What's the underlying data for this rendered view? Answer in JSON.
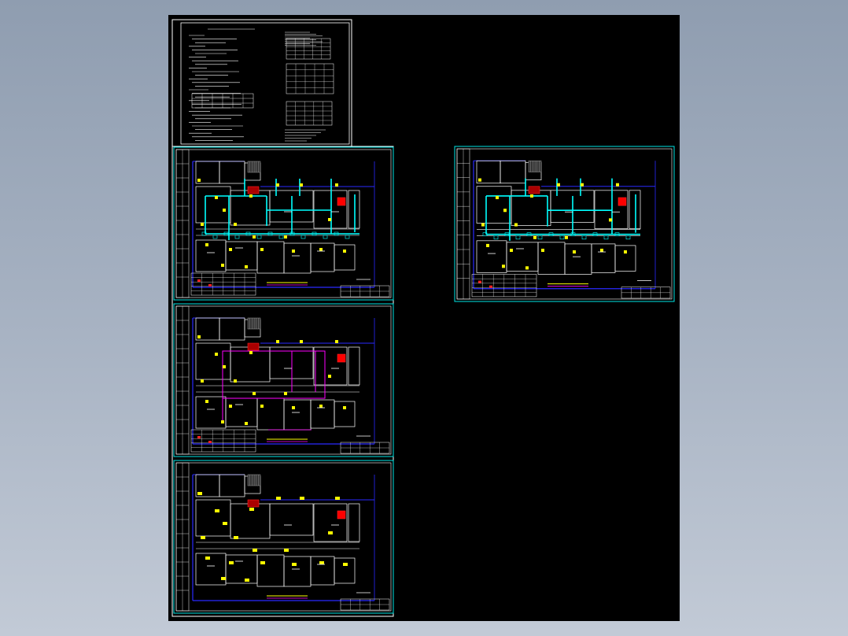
{
  "viewer": {
    "canvas_background": "#000000",
    "outer_background": "#9aa7b8"
  },
  "colors": {
    "frame": "#ffffff",
    "sheet_border": "#00e5e5",
    "wall": "#ffffff",
    "duct": "#00ffff",
    "equipment": "#ffff00",
    "hot_equipment": "#ff2020",
    "structure": "#2a2aff",
    "pipe": "#ff00ff",
    "text": "#ffffff"
  },
  "drawing": {
    "notes_sheet": {},
    "sheets": [
      {
        "id": "sheet-1",
        "style": "duct-cyan",
        "has_legend": true
      },
      {
        "id": "sheet-2",
        "style": "pipe-magenta",
        "has_legend": true
      },
      {
        "id": "sheet-3",
        "style": "equipment-yellow",
        "has_legend": false
      },
      {
        "id": "sheet-4",
        "style": "duct-cyan",
        "has_legend": true
      }
    ]
  }
}
